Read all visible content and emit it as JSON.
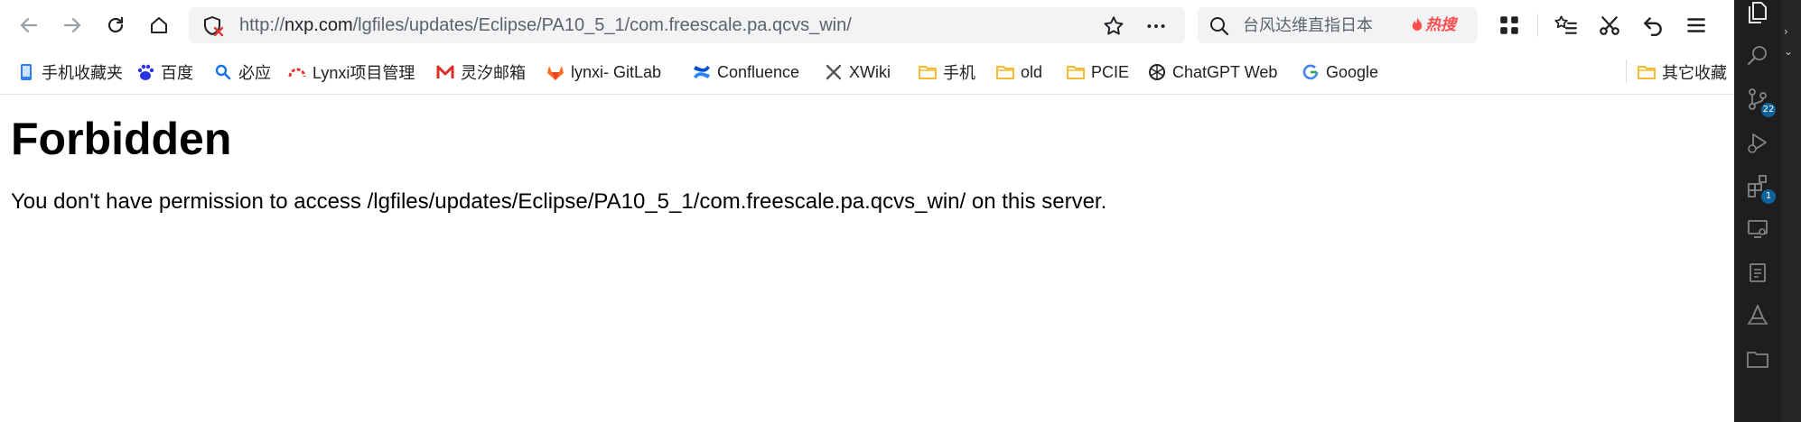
{
  "browser": {
    "url_prefix": "http://",
    "url_host": "nxp.com",
    "url_path": "/lgfiles/updates/Eclipse/PA10_5_1/com.freescale.pa.qcvs_win/",
    "search": {
      "text": "台风达维直指日本",
      "hot_label": "热搜"
    },
    "bookmarks": [
      {
        "label": "手机收藏夹",
        "icon": "phone-icon"
      },
      {
        "label": "百度",
        "icon": "baidu-icon"
      },
      {
        "label": "必应",
        "icon": "bing-search-icon"
      },
      {
        "label": "Lynxi项目管理",
        "icon": "lynxi-icon"
      },
      {
        "label": "灵汐邮箱",
        "icon": "mail-icon"
      },
      {
        "label": "lynxi- GitLab",
        "icon": "gitlab-icon"
      },
      {
        "label": "Confluence",
        "icon": "confluence-icon"
      },
      {
        "label": "XWiki",
        "icon": "xwiki-icon"
      },
      {
        "label": "手机",
        "icon": "folder-icon"
      },
      {
        "label": "old",
        "icon": "folder-icon"
      },
      {
        "label": "PCIE",
        "icon": "folder-icon"
      },
      {
        "label": "ChatGPT Web",
        "icon": "chatgpt-icon"
      },
      {
        "label": "Google",
        "icon": "google-icon"
      }
    ],
    "other_bookmarks": "其它收藏"
  },
  "page": {
    "heading": "Forbidden",
    "message": "You don't have permission to access /lgfiles/updates/Eclipse/PA10_5_1/com.freescale.pa.qcvs_win/ on this server."
  },
  "activity_bar": {
    "source_control_badge": "22",
    "extensions_badge": "1"
  },
  "colors": {
    "folder": "#f5c342",
    "hot": "#ff4d4f",
    "vscode_bg": "#1e1e1e",
    "badge": "#0e639c"
  }
}
